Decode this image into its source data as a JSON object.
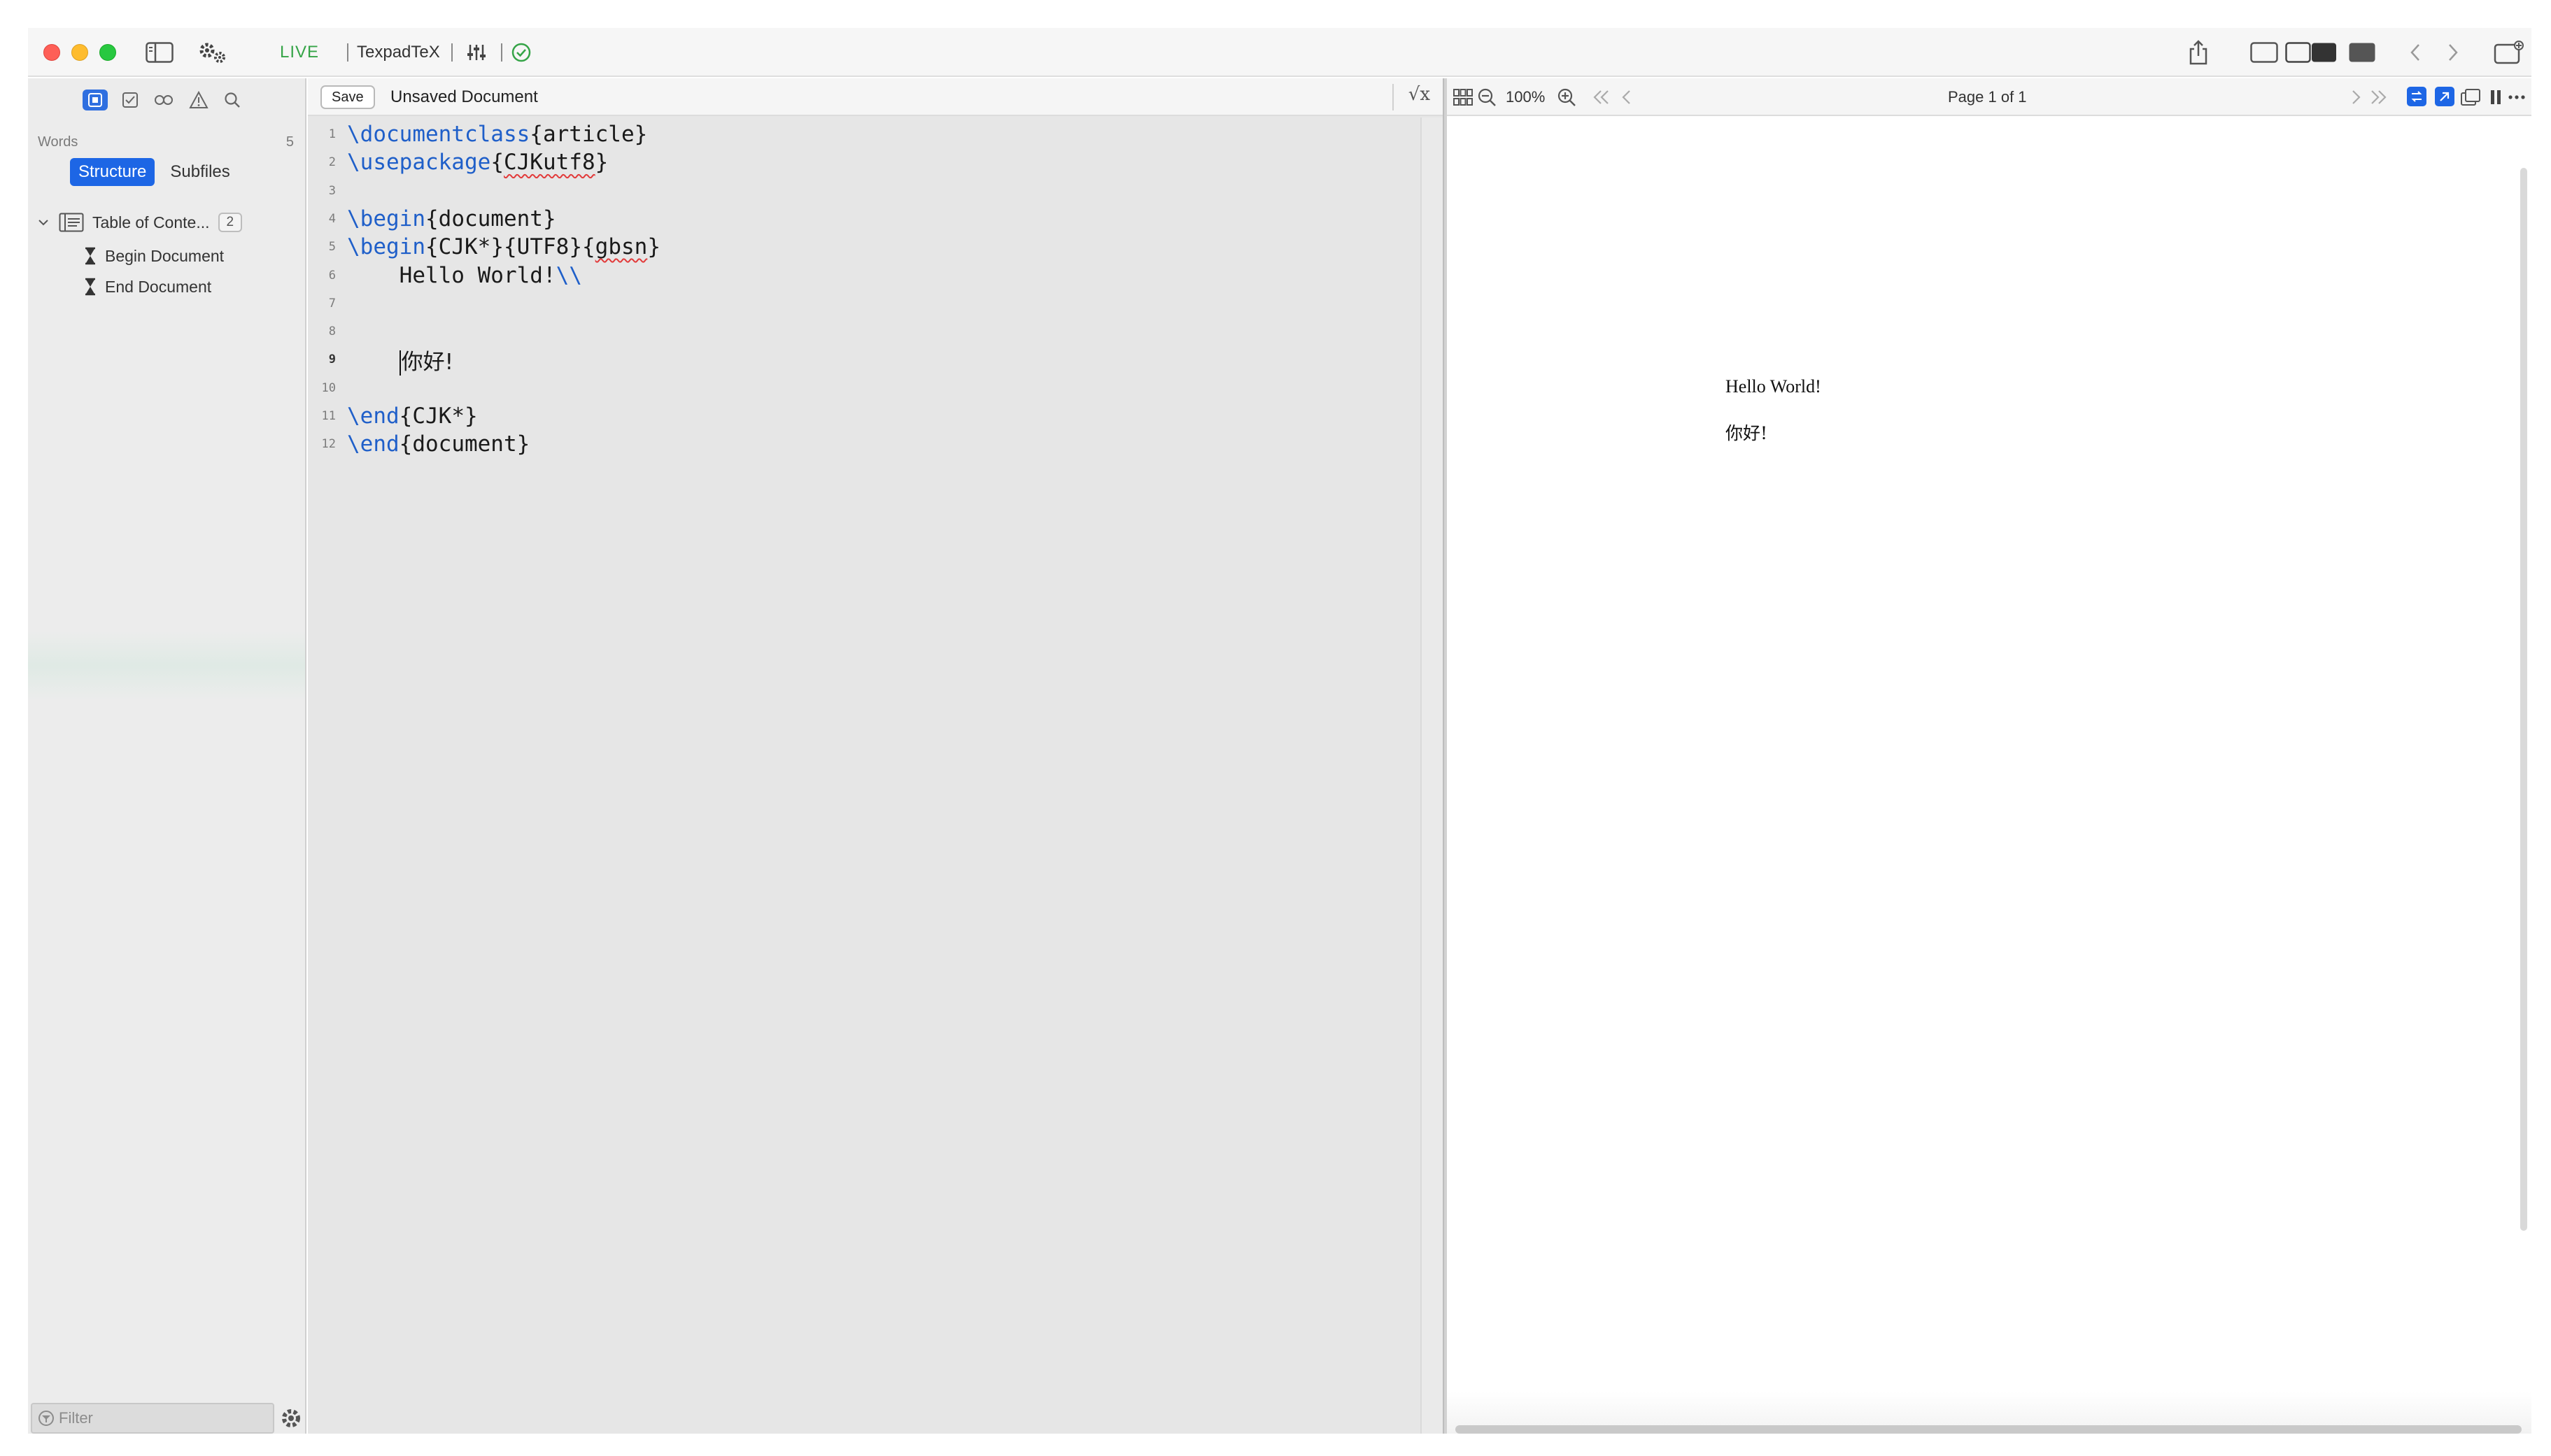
{
  "titlebar": {
    "live_label": "LIVE",
    "app_name": "TexpadTeX"
  },
  "sidebar": {
    "words_label": "Words",
    "words_count": "5",
    "tabs": [
      "Structure",
      "Subfiles"
    ],
    "tree": {
      "root_label": "Table of Conte...",
      "root_badge": "2",
      "children": [
        "Begin Document",
        "End Document"
      ]
    },
    "filter_placeholder": "Filter"
  },
  "editor": {
    "save_label": "Save",
    "doc_title": "Unsaved Document",
    "math_label": "√x",
    "current_line": 9,
    "lines": [
      {
        "n": "1",
        "text": "\\documentclass{article}"
      },
      {
        "n": "2",
        "text": "\\usepackage{CJKutf8}"
      },
      {
        "n": "3",
        "text": ""
      },
      {
        "n": "4",
        "text": "\\begin{document}"
      },
      {
        "n": "5",
        "text": "\\begin{CJK*}{UTF8}{gbsn}"
      },
      {
        "n": "6",
        "text": "    Hello World!\\\\"
      },
      {
        "n": "7",
        "text": ""
      },
      {
        "n": "8",
        "text": ""
      },
      {
        "n": "9",
        "text": "    你好!"
      },
      {
        "n": "10",
        "text": ""
      },
      {
        "n": "11",
        "text": "\\end{CJK*}"
      },
      {
        "n": "12",
        "text": "\\end{document}"
      }
    ]
  },
  "preview": {
    "zoom": "100%",
    "page_label": "Page 1 of 1",
    "content": [
      "Hello World!",
      "你好!"
    ]
  },
  "colors": {
    "accent": "#1d66e5",
    "live_green": "#35a447",
    "keyword_blue": "#1f5fc9",
    "error_red": "#e23b3b"
  },
  "icons": [
    "close-icon",
    "minimize-icon",
    "zoom-icon",
    "sidebar-toggle-icon",
    "gears-icon",
    "sliders-icon",
    "check-circle-icon",
    "share-icon",
    "layout-editor-icon",
    "layout-split-icon",
    "layout-preview-icon",
    "back-icon",
    "forward-icon",
    "new-window-icon",
    "outline-icon",
    "todo-icon",
    "links-icon",
    "warning-icon",
    "search-icon",
    "hourglass-icon",
    "gear-icon",
    "thumbnails-icon",
    "zoom-out-icon",
    "zoom-in-icon",
    "first-page-icon",
    "prev-page-icon",
    "next-page-icon",
    "last-page-icon",
    "sync-icon",
    "jump-icon",
    "popout-icon",
    "pause-icon",
    "more-icon"
  ]
}
